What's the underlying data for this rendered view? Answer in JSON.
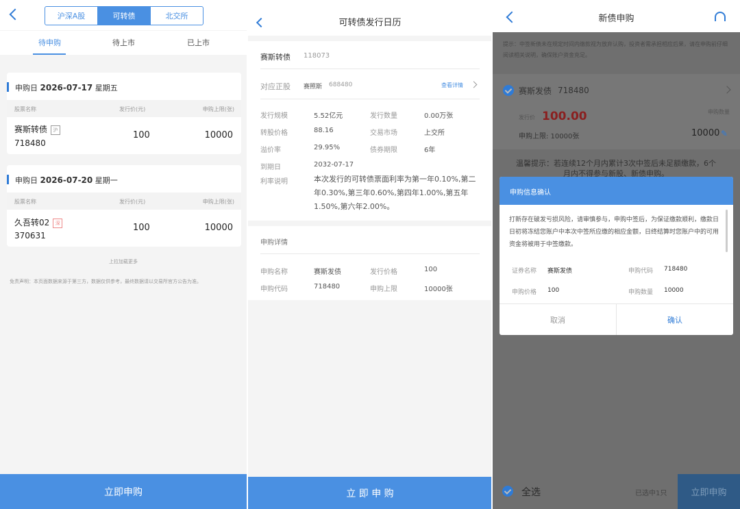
{
  "panel1": {
    "segments": [
      "沪深A股",
      "可转债",
      "北交所"
    ],
    "tabs": [
      "待申购",
      "待上市",
      "已上市"
    ],
    "cards": [
      {
        "date_prefix": "申购日",
        "date": "2026-07-17",
        "weekday": "星期五",
        "col_name": "股票名称",
        "col_price": "发行价(元)",
        "col_limit": "申购上限(张)",
        "name": "赛斯转债",
        "tag": "沪",
        "code": "718480",
        "price": "100",
        "limit": "10000"
      },
      {
        "date_prefix": "申购日",
        "date": "2026-07-20",
        "weekday": "星期一",
        "col_name": "股票名称",
        "col_price": "发行价(元)",
        "col_limit": "申购上限(张)",
        "name": "久吾转02",
        "tag": "深",
        "code": "370631",
        "price": "100",
        "limit": "10000"
      }
    ],
    "pull_more": "上拉加载更多",
    "disclaimer": "免责声明：本页面数据来源于第三方，数据仅供参考，最终数据请以交易所官方公告为准。",
    "button": "立即申购"
  },
  "panel2": {
    "title": "可转债发行日历",
    "bond_name": "赛斯转债",
    "bond_code": "118073",
    "stock_label": "对应正股",
    "stock_name": "赛照斯",
    "stock_code": "688480",
    "detail_link": "查看详情",
    "info": [
      {
        "k1": "发行规模",
        "v1": "5.52亿元",
        "k2": "发行数量",
        "v2": "0.00万张"
      },
      {
        "k1": "转股价格",
        "v1": "88.16",
        "k2": "交易市场",
        "v2": "上交所"
      },
      {
        "k1": "溢价率",
        "v1": "29.95%",
        "k2": "债券期限",
        "v2": "6年"
      }
    ],
    "maturity_label": "到期日",
    "maturity": "2032-07-17",
    "rate_label": "利率说明",
    "rate_desc": "本次发行的可转债票面利率为第一年0.10%,第二年0.30%,第三年0.60%,第四年1.00%,第五年1.50%,第六年2.00%。",
    "detail_title": "申购详情",
    "detail_rows": [
      {
        "k1": "申购名称",
        "v1": "赛斯发债",
        "k2": "发行价格",
        "v2": "100"
      },
      {
        "k1": "申购代码",
        "v1": "718480",
        "k2": "申购上限",
        "v2": "10000张"
      }
    ],
    "button": "立 即 申 购"
  },
  "panel3": {
    "title": "新债申购",
    "notice": "提示：中签新债未在规定时间内缴款视为放弃认购，投资者需承担相应后果，请在申购前仔细阅读相关说明，确保账户资金充足。",
    "item_name": "赛斯发债",
    "item_code": "718480",
    "price_label": "发行价",
    "price": "100.00",
    "qty_label": "申购数量",
    "limit_text": "申购上限: 10000张",
    "qty": "10000",
    "warning": "温馨提示：若连续12个月内累计3次中签后未足额缴款，6个月内不得参与新股、新债申购。",
    "modal": {
      "title": "申购信息确认",
      "body": "打新存在破发亏损风险，请审慎参与，申购中签后，为保证缴款顺利，缴款日日初将冻结您账户中本次中签所应缴的相应金额，日终结算时您账户中的可用资金将被用于中签缴款。",
      "rows": [
        {
          "k1": "证券名称",
          "v1": "赛斯发债",
          "k2": "申购代码",
          "v2": "718480"
        },
        {
          "k1": "申购价格",
          "v1": "100",
          "k2": "申购数量",
          "v2": "10000"
        }
      ],
      "cancel": "取消",
      "confirm": "确认"
    },
    "select_all": "全选",
    "selected": "已选中1只",
    "button": "立即申购"
  }
}
